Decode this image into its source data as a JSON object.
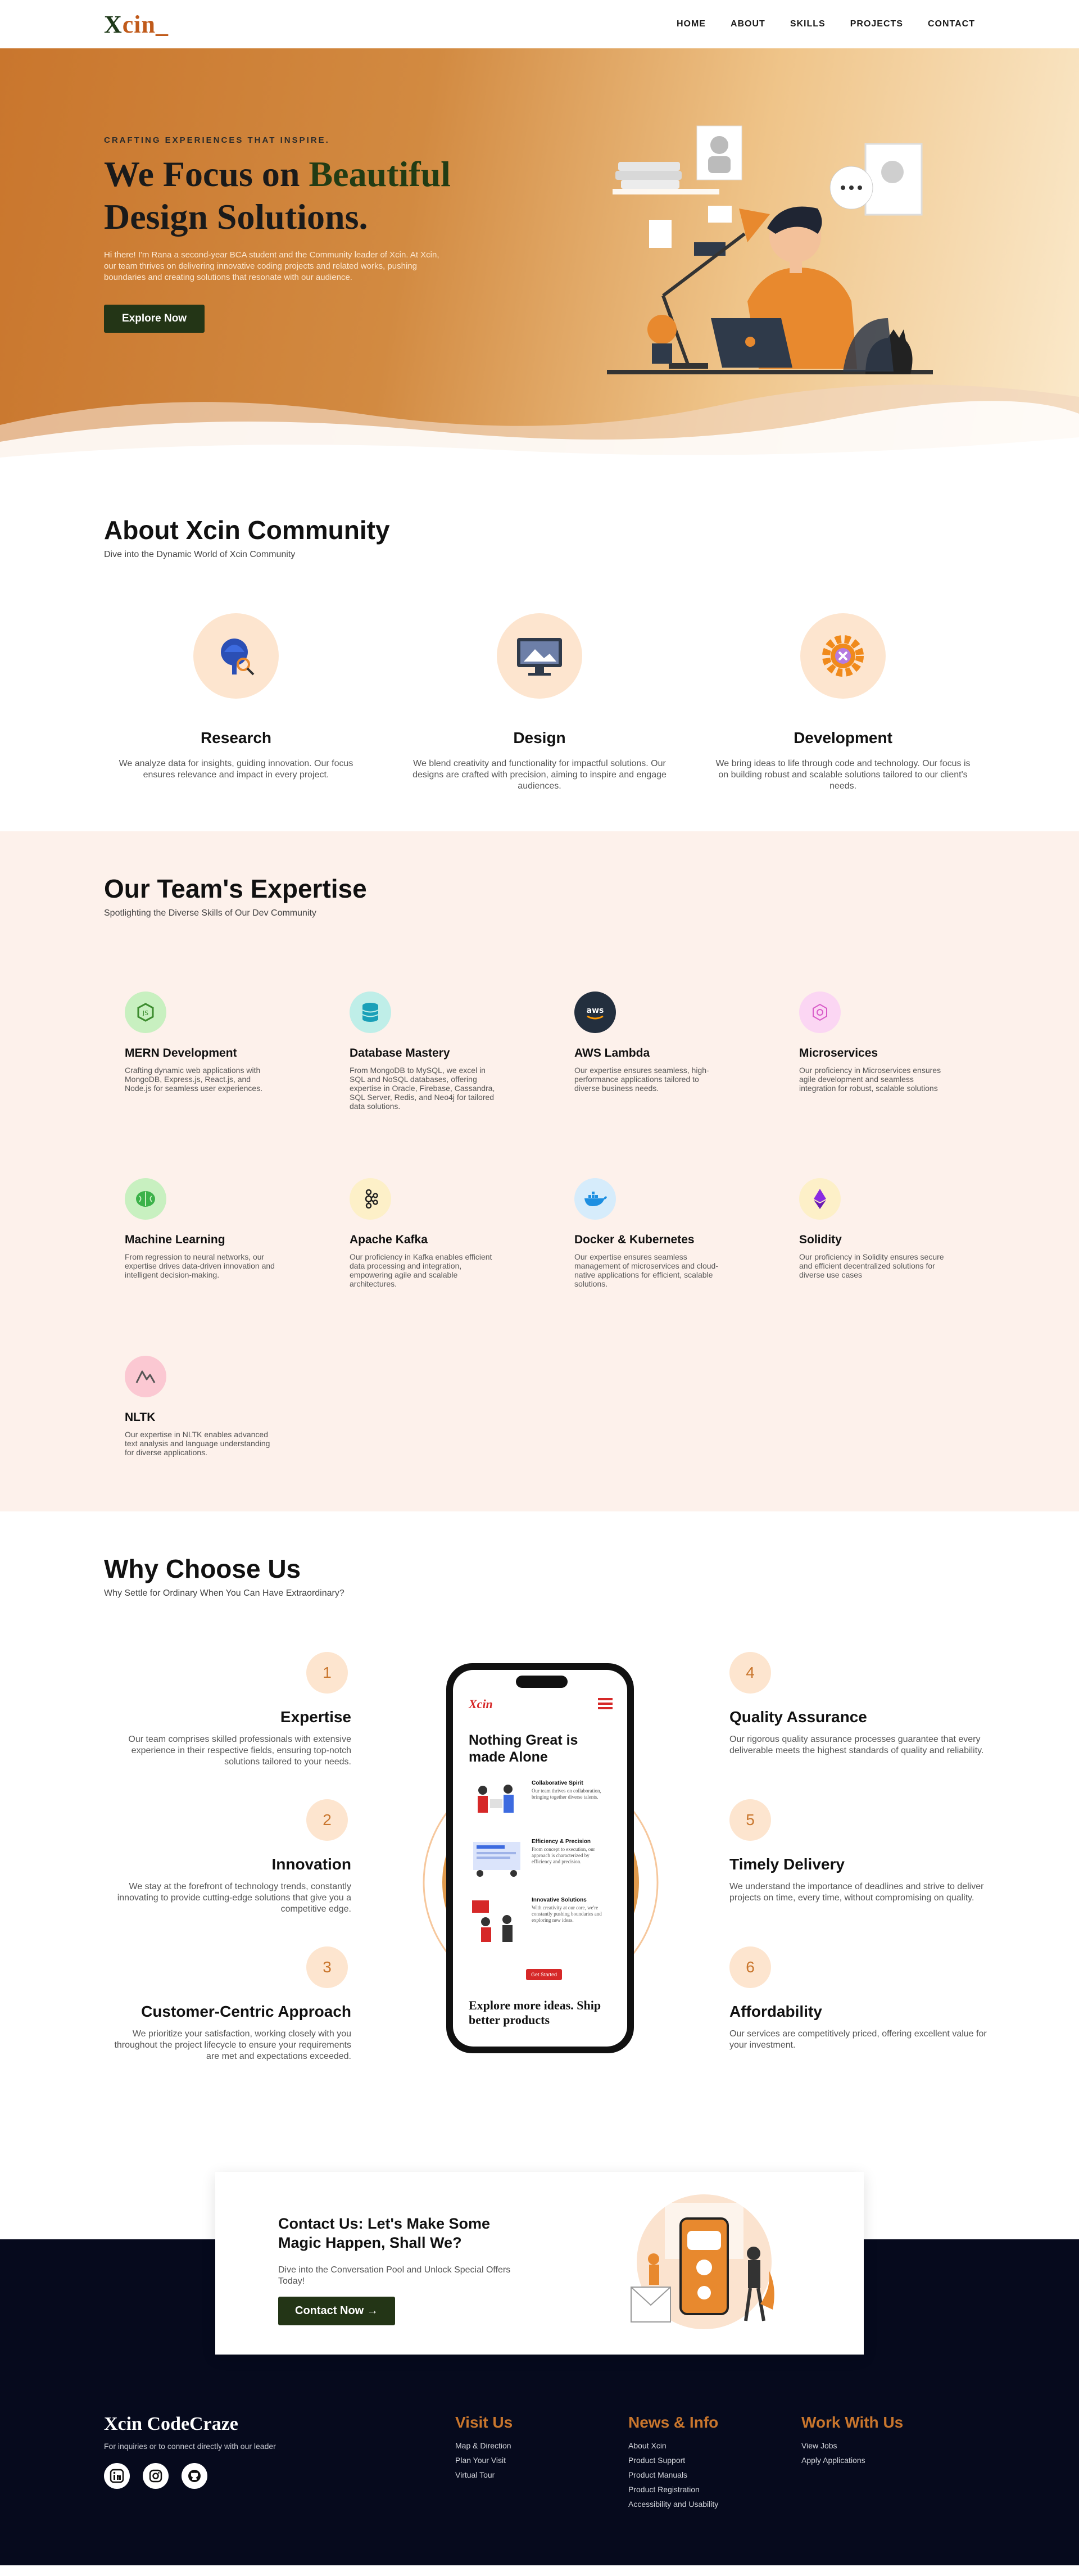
{
  "nav": {
    "logo_x": "X",
    "logo_rest": "cin_",
    "links": [
      "HOME",
      "ABOUT",
      "SKILLS",
      "PROJECTS",
      "CONTACT"
    ]
  },
  "hero": {
    "kicker": "CRAFTING EXPERIENCES THAT INSPIRE.",
    "title_a": "We Focus on ",
    "title_hl": "Beautiful",
    "title_b": "Design Solutions.",
    "desc": "Hi there! I'm Rana a second-year BCA student and the Community leader of Xcin. At Xcin, our team thrives on delivering innovative coding projects and related works, pushing boundaries and creating solutions that resonate with our audience.",
    "cta": "Explore Now"
  },
  "about": {
    "title": "About Xcin Community",
    "subtitle": "Dive into the Dynamic World of Xcin Community",
    "cards": [
      {
        "title": "Research",
        "text": "We analyze data for insights, guiding innovation. Our focus ensures relevance and impact in every project.",
        "icon": "research-icon"
      },
      {
        "title": "Design",
        "text": "We blend creativity and functionality for impactful solutions. Our designs are crafted with precision, aiming to inspire and engage audiences.",
        "icon": "design-icon"
      },
      {
        "title": "Development",
        "text": "We bring ideas to life through code and technology. Our focus is on building robust and scalable solutions tailored to our client's needs.",
        "icon": "development-gear-icon"
      }
    ]
  },
  "expertise": {
    "title": "Our Team's Expertise",
    "subtitle": "Spotlighting the Diverse Skills of Our Dev Community",
    "items": [
      {
        "title": "MERN Development",
        "text": "Crafting dynamic web applications with MongoDB, Express.js, React.js, and Node.js for seamless user experiences.",
        "color": "#c8f0c0",
        "icon": "nodejs-icon"
      },
      {
        "title": "Database Mastery",
        "text": "From MongoDB to MySQL, we excel in SQL and NoSQL databases, offering expertise in Oracle, Firebase, Cassandra, SQL Server, Redis, and Neo4j for tailored data solutions.",
        "color": "#bfeee8",
        "icon": "database-icon"
      },
      {
        "title": "AWS Lambda",
        "text": "Our expertise ensures seamless, high-performance applications tailored to diverse business needs.",
        "color": "#232f3e",
        "icon": "aws-icon"
      },
      {
        "title": "Microservices",
        "text": "Our proficiency in Microservices ensures agile development and seamless integration for robust, scalable solutions",
        "color": "#fbd6f3",
        "icon": "microservices-icon"
      },
      {
        "title": "Machine Learning",
        "text": "From regression to neural networks, our expertise drives data-driven innovation and intelligent decision-making.",
        "color": "#c8f0c0",
        "icon": "brain-icon"
      },
      {
        "title": "Apache Kafka",
        "text": "Our proficiency in Kafka enables efficient data processing and integration, empowering agile and scalable architectures.",
        "color": "#fdf0c8",
        "icon": "kafka-icon"
      },
      {
        "title": "Docker & Kubernetes",
        "text": "Our expertise ensures seamless management of microservices and cloud-native applications for efficient, scalable solutions.",
        "color": "#d6ecfb",
        "icon": "docker-icon"
      },
      {
        "title": "Solidity",
        "text": "Our proficiency in Solidity ensures secure and efficient decentralized solutions for diverse use cases",
        "color": "#fdf0c8",
        "icon": "ethereum-icon"
      },
      {
        "title": "NLTK",
        "text": "Our expertise in NLTK enables advanced text analysis and language understanding for diverse applications.",
        "color": "#fbc8d2",
        "icon": "nltk-icon"
      }
    ]
  },
  "why": {
    "title": "Why Choose Us",
    "subtitle": "Why Settle for Ordinary When You Can Have Extraordinary?",
    "left": [
      {
        "num": "1",
        "title": "Expertise",
        "text": "Our team comprises skilled professionals with extensive experience in their respective fields, ensuring top-notch solutions tailored to your needs."
      },
      {
        "num": "2",
        "title": "Innovation",
        "text": "We stay at the forefront of technology trends, constantly innovating to provide cutting-edge solutions that give you a competitive edge."
      },
      {
        "num": "3",
        "title": "Customer-Centric Approach",
        "text": "We prioritize your satisfaction, working closely with you throughout the project lifecycle to ensure your requirements are met and expectations exceeded."
      }
    ],
    "right": [
      {
        "num": "4",
        "title": "Quality Assurance",
        "text": "Our rigorous quality assurance processes guarantee that every deliverable meets the highest standards of quality and reliability."
      },
      {
        "num": "5",
        "title": "Timely Delivery",
        "text": "We understand the importance of deadlines and strive to deliver projects on time, every time, without compromising on quality."
      },
      {
        "num": "6",
        "title": "Affordability",
        "text": "Our services are competitively priced, offering excellent value for your investment."
      }
    ],
    "phone": {
      "logo": "Xcin",
      "heading": "Nothing Great is made Alone",
      "features": [
        {
          "title": "Collaborative Spirit",
          "text": "Our team thrives on collaboration, bringing together diverse talents."
        },
        {
          "title": "Efficiency & Precision",
          "text": "From concept to execution, our approach is characterized by efficiency and precision."
        },
        {
          "title": "Innovative Solutions",
          "text": "With creativity at our core, we're constantly pushing boundaries and exploring new ideas."
        }
      ],
      "btn": "Get Started",
      "footer": "Explore more ideas. Ship better products"
    }
  },
  "contact": {
    "title": "Contact Us: Let's Make Some Magic Happen, Shall We?",
    "subtitle": "Dive into the Conversation Pool and Unlock Special Offers Today!",
    "cta": "Contact Now →"
  },
  "footer": {
    "brand": "Xcin CodeCraze",
    "tagline": "For inquiries or to connect directly with our leader",
    "socials": [
      "linkedin-icon",
      "instagram-icon",
      "github-icon"
    ],
    "cols": [
      {
        "title": "Visit Us",
        "items": [
          "Map & Direction",
          "Plan Your Visit",
          "Virtual Tour"
        ]
      },
      {
        "title": "News & Info",
        "items": [
          "About Xcin",
          "Product Support",
          "Product Manuals",
          "Product Registration",
          "Accessibility and Usability"
        ]
      },
      {
        "title": "Work With Us",
        "items": [
          "View Jobs",
          "Apply Applications"
        ]
      }
    ]
  },
  "colors": {
    "accent": "#c9762d",
    "dark_green": "#233516",
    "navy": "#060a1d",
    "soft_peach": "#fdf1eb"
  }
}
